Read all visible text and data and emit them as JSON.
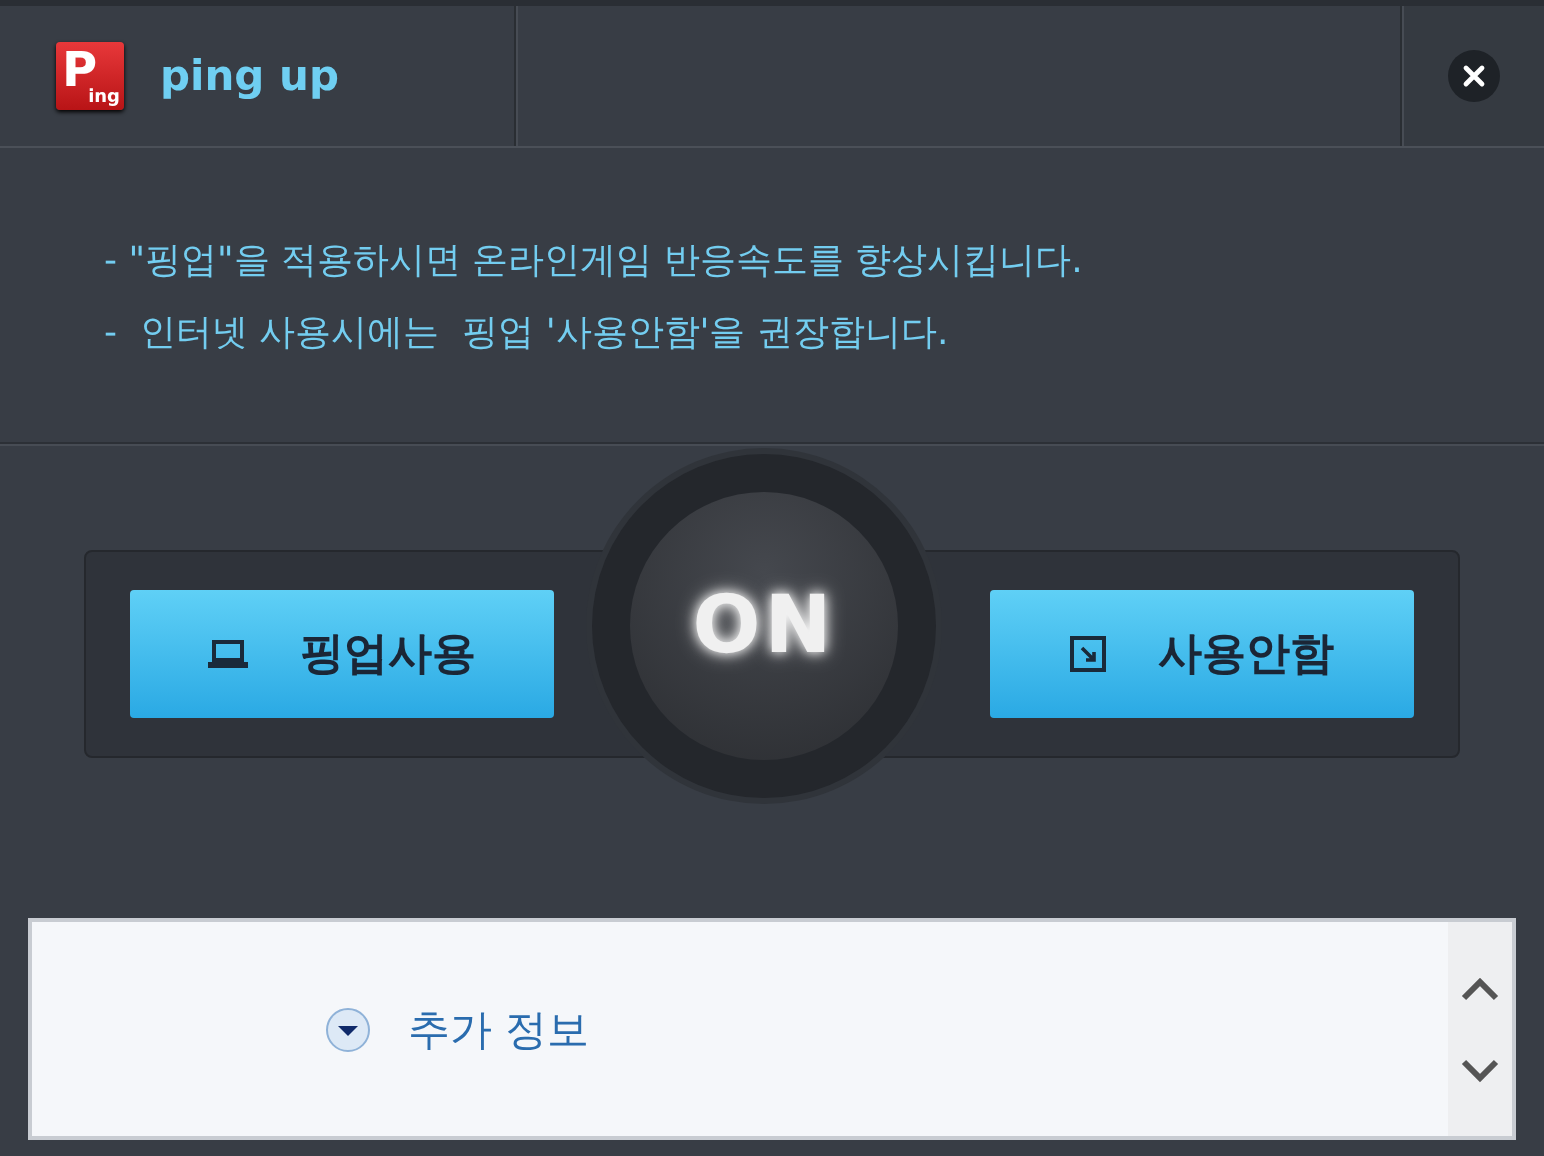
{
  "window": {
    "title": "ping up",
    "logo": {
      "initial": "P",
      "rest": "ing"
    }
  },
  "notes": [
    "- \"핑업\"을 적용하시면 온라인게임 반응속도를 향상시킵니다.",
    "-  인터넷 사용시에는  핑업 '사용안함'을 권장합니다."
  ],
  "buttons": [
    {
      "kind": "enable",
      "label": "핑업사용"
    },
    {
      "kind": "disable",
      "label": "사용안함"
    }
  ],
  "power": {
    "label": "ON",
    "on": true
  },
  "more_info": {
    "label": "추가 정보",
    "expanded": false
  }
}
